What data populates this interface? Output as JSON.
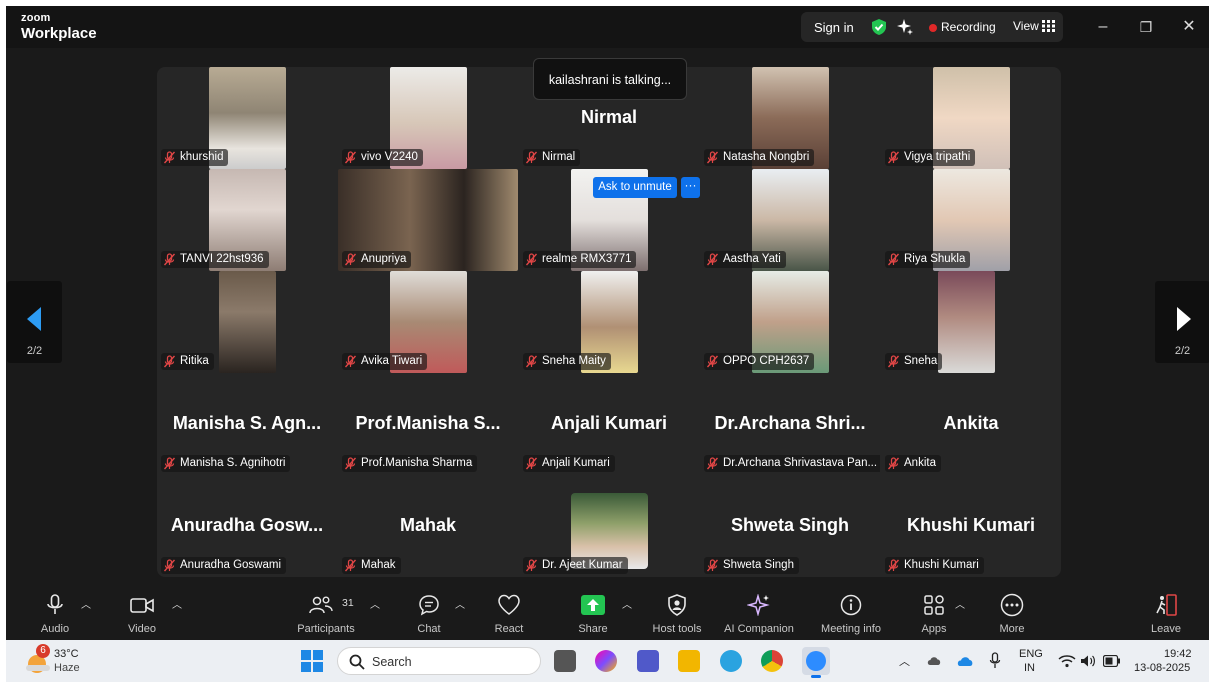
{
  "titlebar": {
    "brand_small": "zoom",
    "brand_large": "Workplace",
    "sign_in": "Sign in",
    "recording": "Recording",
    "view": "View",
    "minimize": "–",
    "restore": "❐",
    "close": "✕"
  },
  "talking_banner": "kailashrani is talking...",
  "ask_to_unmute": "Ask to unmute",
  "more_dots": "···",
  "page_left": "2/2",
  "page_right": "2/2",
  "participants": [
    {
      "label": "khurshid",
      "big": ""
    },
    {
      "label": "vivo V2240",
      "big": ""
    },
    {
      "label": "Nirmal",
      "big": "Nirmal"
    },
    {
      "label": "Natasha Nongbri",
      "big": ""
    },
    {
      "label": "Vigya tripathi",
      "big": ""
    },
    {
      "label": "TANVI 22hst936",
      "big": ""
    },
    {
      "label": "Anupriya",
      "big": ""
    },
    {
      "label": "realme RMX3771",
      "big": ""
    },
    {
      "label": "Aastha Yati",
      "big": ""
    },
    {
      "label": "Riya Shukla",
      "big": ""
    },
    {
      "label": "Ritika",
      "big": ""
    },
    {
      "label": "Avika Tiwari",
      "big": ""
    },
    {
      "label": "Sneha Maity",
      "big": ""
    },
    {
      "label": "OPPO CPH2637",
      "big": ""
    },
    {
      "label": "Sneha",
      "big": ""
    },
    {
      "label": "Manisha S. Agnihotri",
      "big": "Manisha S. Agn..."
    },
    {
      "label": "Prof.Manisha Sharma",
      "big": "Prof.Manisha S..."
    },
    {
      "label": "Anjali Kumari",
      "big": "Anjali Kumari"
    },
    {
      "label": "Dr.Archana Shrivastava Pan...",
      "big": "Dr.Archana Shri..."
    },
    {
      "label": "Ankita",
      "big": "Ankita"
    },
    {
      "label": "Anuradha Goswami",
      "big": "Anuradha Gosw..."
    },
    {
      "label": "Mahak",
      "big": "Mahak"
    },
    {
      "label": "Dr. Ajeet Kumar",
      "big": ""
    },
    {
      "label": "Shweta Singh",
      "big": "Shweta Singh"
    },
    {
      "label": "Khushi Kumari",
      "big": "Khushi Kumari"
    }
  ],
  "toolbar": {
    "audio": "Audio",
    "video": "Video",
    "participants": "Participants",
    "participants_count": "31",
    "chat": "Chat",
    "react": "React",
    "share": "Share",
    "host_tools": "Host tools",
    "ai_companion": "AI Companion",
    "meeting_info": "Meeting info",
    "apps": "Apps",
    "more": "More",
    "leave": "Leave"
  },
  "taskbar": {
    "weather_badge": "6",
    "temperature": "33°C",
    "condition": "Haze",
    "search": "Search",
    "lang_top": "ENG",
    "lang_bottom": "IN",
    "time": "19:42",
    "date": "13-08-2025"
  },
  "colors": {
    "accent": "#0e71eb",
    "recording": "#e02828",
    "mute": "#e04646",
    "share": "#23c552"
  }
}
